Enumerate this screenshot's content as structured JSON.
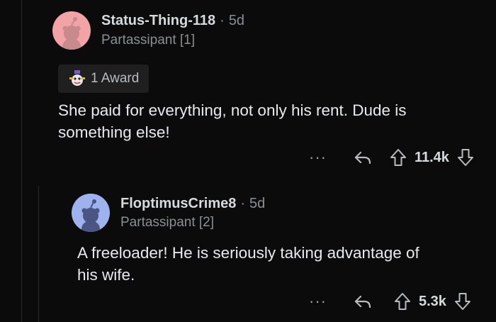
{
  "comments": [
    {
      "username": "Status-Thing-118",
      "separator": "·",
      "age": "5d",
      "flair": "Partassipant [1]",
      "award_label": "1 Award",
      "body_line1": "She paid for everything, not only his rent. Dude is",
      "body_line2": "something else!",
      "more_label": "···",
      "score": "11.4k",
      "avatar_color": "#f2a3a6"
    },
    {
      "username": "FloptimusCrime8",
      "separator": "·",
      "age": "5d",
      "flair": "Partassipant [2]",
      "body_line1": "A freeloader! He is seriously taking advantage of",
      "body_line2": "his wife.",
      "more_label": "···",
      "score": "5.3k",
      "avatar_color": "#9eb2ee"
    }
  ],
  "icons": {
    "reply": "reply-icon",
    "upvote": "upvote-arrow-icon",
    "downvote": "downvote-arrow-icon",
    "award": "award-icon"
  }
}
